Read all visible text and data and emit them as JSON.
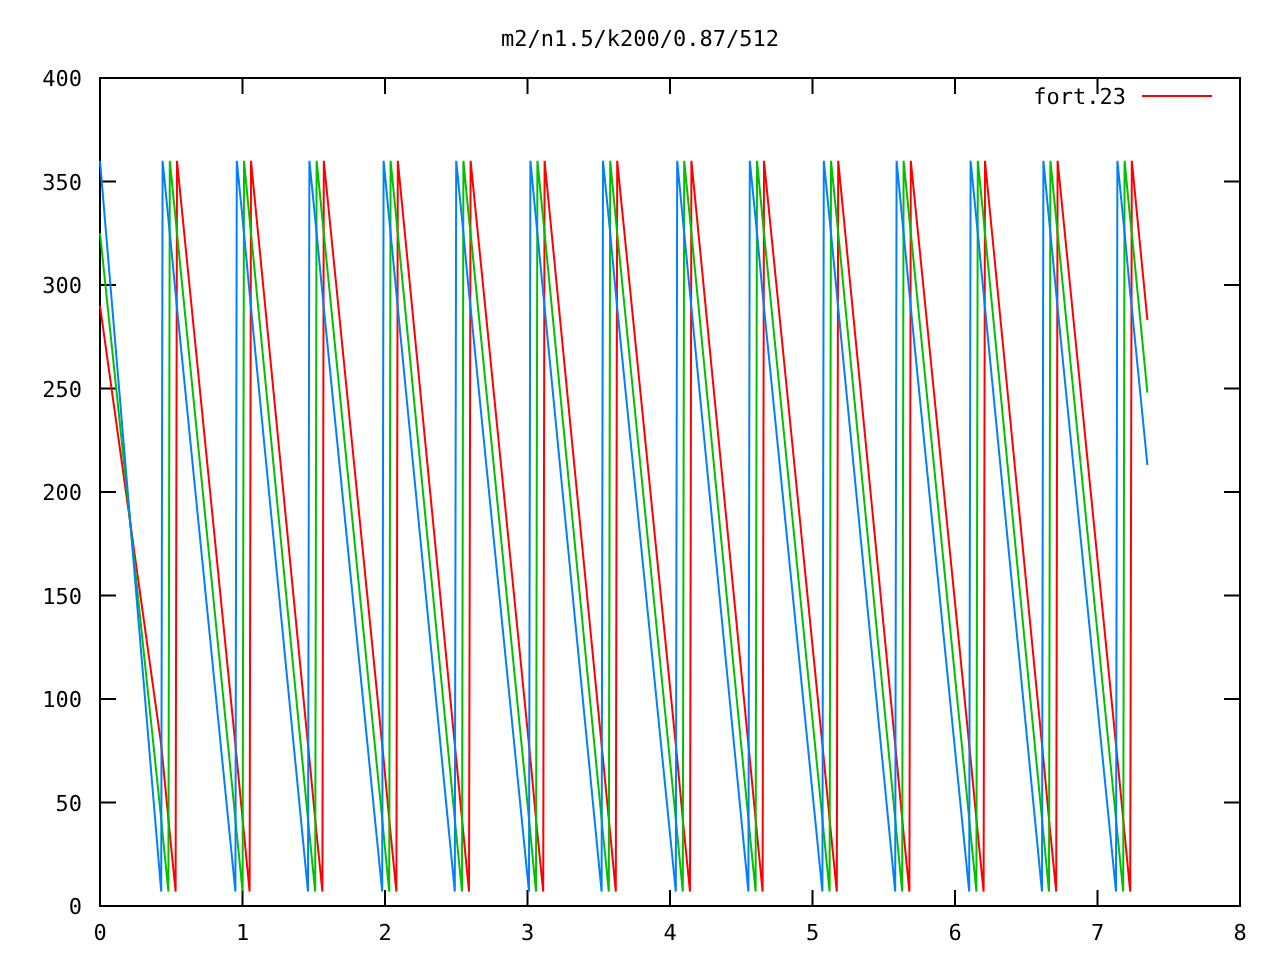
{
  "chart_data": {
    "type": "line",
    "title": "m2/n1.5/k200/0.87/512",
    "xlim": [
      0,
      8
    ],
    "ylim": [
      0,
      400
    ],
    "xticks": [
      0,
      1,
      2,
      3,
      4,
      5,
      6,
      7,
      8
    ],
    "yticks": [
      0,
      50,
      100,
      150,
      200,
      250,
      300,
      350,
      400
    ],
    "x": [
      0,
      0.43,
      0.44,
      0.48,
      0.49,
      0.53,
      0.54,
      0.95,
      0.96,
      1.0,
      1.01,
      1.05,
      1.06,
      1.46,
      1.47,
      1.51,
      1.52,
      1.56,
      1.57,
      1.98,
      1.99,
      2.03,
      2.04,
      2.08,
      2.09,
      2.49,
      2.5,
      2.54,
      2.55,
      2.59,
      2.6,
      3.01,
      3.02,
      3.06,
      3.07,
      3.11,
      3.12,
      3.52,
      3.53,
      3.57,
      3.58,
      3.62,
      3.63,
      4.04,
      4.05,
      4.09,
      4.1,
      4.14,
      4.15,
      4.55,
      4.56,
      4.6,
      4.61,
      4.65,
      4.66,
      5.07,
      5.08,
      5.12,
      5.13,
      5.17,
      5.18,
      5.58,
      5.59,
      5.63,
      5.64,
      5.68,
      5.69,
      6.1,
      6.11,
      6.15,
      6.16,
      6.2,
      6.21,
      6.61,
      6.62,
      6.66,
      6.67,
      6.71,
      6.72,
      7.13,
      7.14,
      7.18,
      7.19,
      7.23,
      7.24,
      7.35
    ],
    "series": [
      {
        "name": "fort.23",
        "color": "#ff0000",
        "values": [
          290,
          78,
          71,
          42,
          35,
          7,
          360,
          78,
          71,
          42,
          35,
          7,
          360,
          78,
          71,
          42,
          35,
          7,
          360,
          78,
          71,
          42,
          35,
          7,
          360,
          78,
          71,
          42,
          35,
          7,
          360,
          78,
          71,
          42,
          35,
          7,
          360,
          78,
          71,
          42,
          35,
          7,
          360,
          78,
          71,
          42,
          35,
          7,
          360,
          78,
          71,
          42,
          35,
          7,
          360,
          78,
          71,
          42,
          35,
          7,
          360,
          78,
          71,
          42,
          35,
          7,
          360,
          78,
          71,
          42,
          35,
          7,
          360,
          78,
          71,
          42,
          35,
          7,
          360,
          78,
          71,
          42,
          35,
          7,
          360,
          283
        ]
      },
      {
        "color": "#00c000",
        "values": [
          325,
          42,
          35,
          7,
          360,
          332,
          325,
          42,
          35,
          7,
          360,
          332,
          325,
          42,
          35,
          7,
          360,
          332,
          325,
          42,
          35,
          7,
          360,
          332,
          325,
          42,
          35,
          7,
          360,
          332,
          325,
          42,
          35,
          7,
          360,
          332,
          325,
          42,
          35,
          7,
          360,
          332,
          325,
          42,
          35,
          7,
          360,
          332,
          325,
          42,
          35,
          7,
          360,
          332,
          325,
          42,
          35,
          7,
          360,
          332,
          325,
          42,
          35,
          7,
          360,
          332,
          325,
          42,
          35,
          7,
          360,
          332,
          325,
          42,
          35,
          7,
          360,
          332,
          325,
          42,
          35,
          7,
          360,
          332,
          325,
          248
        ]
      },
      {
        "color": "#0080ff",
        "values": [
          360,
          7,
          360,
          332,
          325,
          296,
          289,
          7,
          360,
          332,
          325,
          296,
          289,
          7,
          360,
          332,
          325,
          296,
          289,
          7,
          360,
          332,
          325,
          296,
          289,
          7,
          360,
          332,
          325,
          296,
          289,
          7,
          360,
          332,
          325,
          296,
          289,
          7,
          360,
          332,
          325,
          296,
          289,
          7,
          360,
          332,
          325,
          296,
          289,
          7,
          360,
          332,
          325,
          296,
          289,
          7,
          360,
          332,
          325,
          296,
          289,
          7,
          360,
          332,
          325,
          296,
          289,
          7,
          360,
          332,
          325,
          296,
          289,
          7,
          360,
          332,
          325,
          296,
          289,
          7,
          360,
          332,
          325,
          296,
          289,
          213
        ]
      }
    ]
  }
}
